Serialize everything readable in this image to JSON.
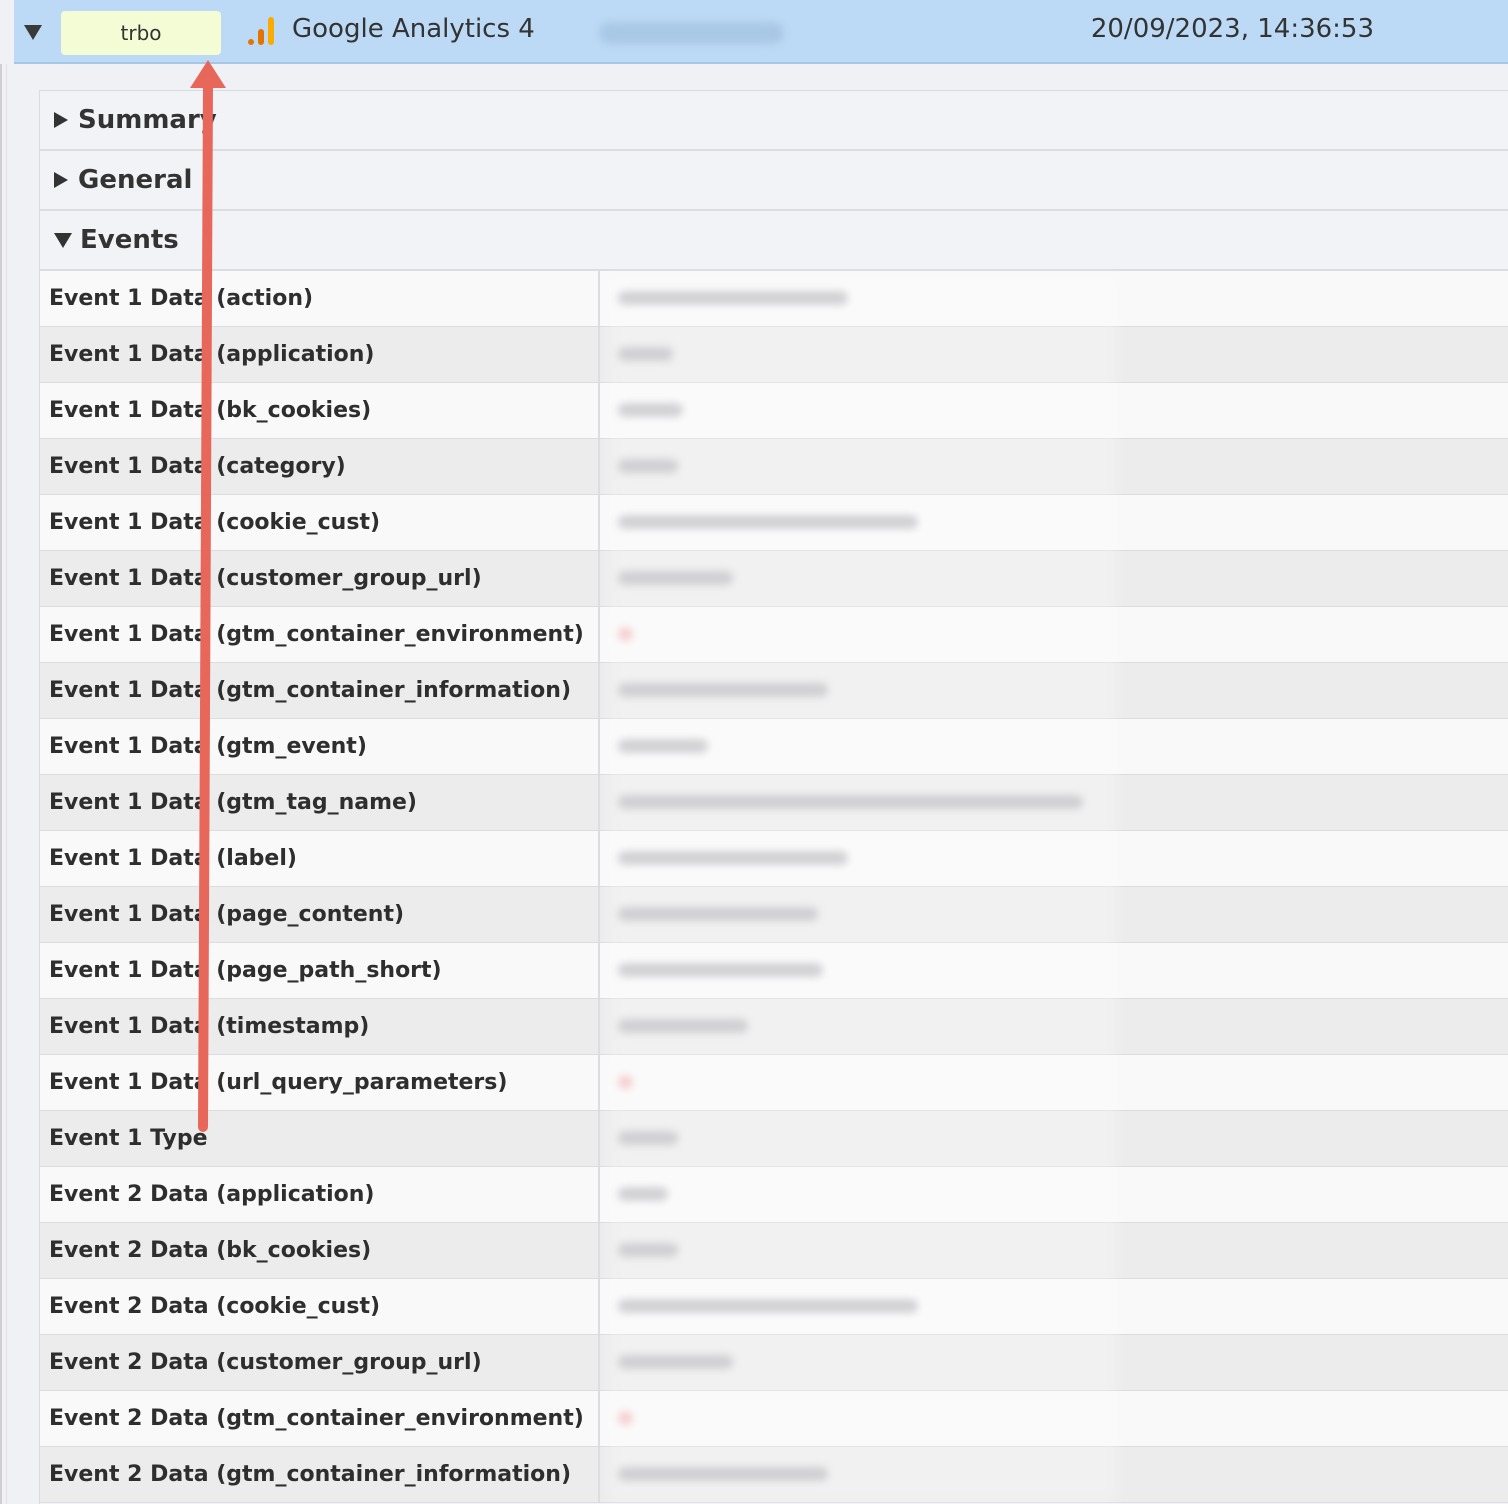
{
  "header": {
    "tag_label": "trbo",
    "title": "Google Analytics 4",
    "timestamp": "20/09/2023, 14:36:53"
  },
  "sections": [
    {
      "label": "Summary",
      "expanded": false
    },
    {
      "label": "General",
      "expanded": false
    },
    {
      "label": "Events",
      "expanded": true
    }
  ],
  "rows": [
    "Event 1 Data (action)",
    "Event 1 Data (application)",
    "Event 1 Data (bk_cookies)",
    "Event 1 Data (category)",
    "Event 1 Data (cookie_cust)",
    "Event 1 Data (customer_group_url)",
    "Event 1 Data (gtm_container_environment)",
    "Event 1 Data (gtm_container_information)",
    "Event 1 Data (gtm_event)",
    "Event 1 Data (gtm_tag_name)",
    "Event 1 Data (label)",
    "Event 1 Data (page_content)",
    "Event 1 Data (page_path_short)",
    "Event 1 Data (timestamp)",
    "Event 1 Data (url_query_parameters)",
    "Event 1 Type",
    "Event 2 Data (application)",
    "Event 2 Data (bk_cookies)",
    "Event 2 Data (cookie_cust)",
    "Event 2 Data (customer_group_url)",
    "Event 2 Data (gtm_container_environment)",
    "Event 2 Data (gtm_container_information)"
  ],
  "colors": {
    "header_bg": "#bcdaf5",
    "tag_bg": "#f4fcd5",
    "arrow": "#e8675b"
  },
  "icons": {
    "collapse": "triangle-down-icon",
    "analytics": "google-analytics-icon"
  }
}
